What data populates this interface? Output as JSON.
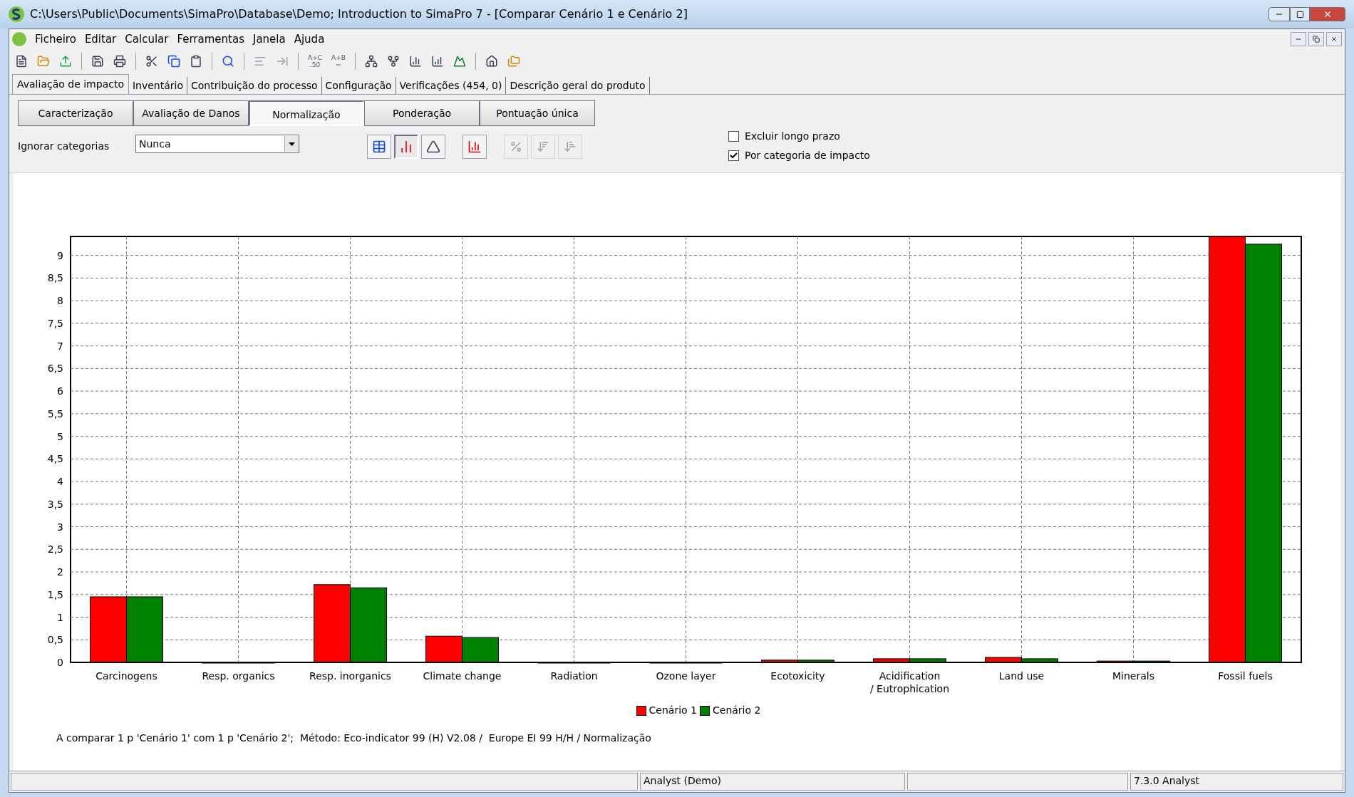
{
  "window": {
    "title": "C:\\Users\\Public\\Documents\\SimaPro\\Database\\Demo; Introduction to SimaPro 7 - [Comparar Cenário 1 e Cenário 2]"
  },
  "menu": [
    "Ficheiro",
    "Editar",
    "Calcular",
    "Ferramentas",
    "Janela",
    "Ajuda"
  ],
  "toolbar_text_buttons": [
    "A+C .50",
    "A+B ="
  ],
  "tabs": [
    {
      "label": "Avaliação de impacto",
      "selected": true
    },
    {
      "label": "Inventário",
      "selected": false
    },
    {
      "label": "Contribuição do processo",
      "selected": false
    },
    {
      "label": "Configuração",
      "selected": false
    },
    {
      "label": "Verificações (454, 0)",
      "selected": false
    },
    {
      "label": "Descrição geral do produto",
      "selected": false
    }
  ],
  "subtabs": [
    {
      "label": "Caracterização",
      "selected": false
    },
    {
      "label": "Avaliação de Danos",
      "selected": false
    },
    {
      "label": "Normalização",
      "selected": true
    },
    {
      "label": "Ponderação",
      "selected": false
    },
    {
      "label": "Pontuação única",
      "selected": false
    }
  ],
  "ignore": {
    "label": "Ignorar categorias",
    "value": "Nunca"
  },
  "view_buttons": [
    {
      "selected": false
    },
    {
      "selected": true
    },
    {
      "selected": false
    }
  ],
  "checkboxes": [
    {
      "label": "Excluir longo prazo",
      "checked": false
    },
    {
      "label": "Por categoria de impacto",
      "checked": true
    }
  ],
  "chart_data": {
    "type": "bar",
    "categories": [
      "Carcinogens",
      "Resp. organics",
      "Resp. inorganics",
      "Climate change",
      "Radiation",
      "Ozone layer",
      "Ecotoxicity",
      "Acidification\n/ Eutrophication",
      "Land use",
      "Minerals",
      "Fossil fuels"
    ],
    "series": [
      {
        "name": "Cenário 1",
        "color": "#ff0000",
        "values": [
          1.45,
          0,
          1.72,
          0.58,
          0,
          0,
          0.05,
          0.08,
          0.11,
          0.03,
          9.42
        ]
      },
      {
        "name": "Cenário 2",
        "color": "#008000",
        "values": [
          1.45,
          0,
          1.65,
          0.55,
          0,
          0,
          0.05,
          0.08,
          0.08,
          0.03,
          9.25
        ]
      }
    ],
    "ylim": [
      0,
      9.42
    ],
    "grid": true,
    "yticks": [
      {
        "value": 0,
        "label": "0"
      },
      {
        "value": 0.5,
        "label": "0,5"
      },
      {
        "value": 1,
        "label": "1"
      },
      {
        "value": 1.5,
        "label": "1,5"
      },
      {
        "value": 2,
        "label": "2"
      },
      {
        "value": 2.5,
        "label": "2,5"
      },
      {
        "value": 3,
        "label": "3"
      },
      {
        "value": 3.5,
        "label": "3,5"
      },
      {
        "value": 4,
        "label": "4"
      },
      {
        "value": 4.5,
        "label": "4,5"
      },
      {
        "value": 5,
        "label": "5"
      },
      {
        "value": 5.5,
        "label": "5,5"
      },
      {
        "value": 6,
        "label": "6"
      },
      {
        "value": 6.5,
        "label": "6,5"
      },
      {
        "value": 7,
        "label": "7"
      },
      {
        "value": 7.5,
        "label": "7,5"
      },
      {
        "value": 8,
        "label": "8"
      },
      {
        "value": 8.5,
        "label": "8,5"
      },
      {
        "value": 9,
        "label": "9"
      }
    ]
  },
  "caption": "A comparar 1 p 'Cenário 1' com 1 p 'Cenário 2';  Método: Eco-indicator 99 (H) V2.08 /  Europe EI 99 H/H / Normalização",
  "status_bar": [
    "Analyst (Demo)",
    "7.3.0 Analyst"
  ]
}
